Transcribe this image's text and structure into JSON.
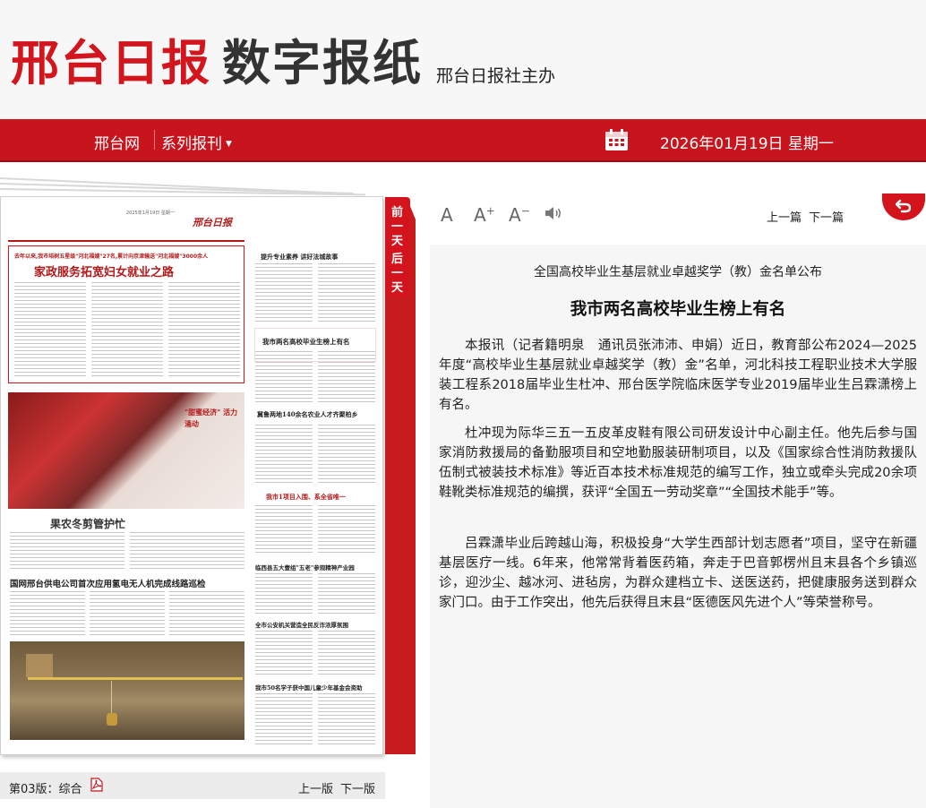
{
  "header": {
    "logo_red": "邢台日报",
    "logo_dark": "数字报纸",
    "subtitle": "邢台日报社主办"
  },
  "nav": {
    "site": "邢台网",
    "series": "系列报刊",
    "date": "2026年01月19日 星期一"
  },
  "side_tab": [
    "前",
    "一",
    "天",
    "后",
    "一",
    "天"
  ],
  "thumbnail": {
    "logo": "邢台日报",
    "section": "综合 3",
    "dateline": "2025年1月19日 星期一",
    "top_kicker": "去年以来,我市培树五星级\"河北福嫂\"27名,累计向京津输送\"河北福嫂\"3000余人",
    "top_title": "家政服务拓宽妇女就业之路",
    "photo_tag": "\"甜蜜经济\" 活力涌动",
    "h2": "果农冬剪管护忙",
    "h3": "国网邢台供电公司首次应用氢电无人机完成线路巡检",
    "r1": "提升专业素养  讲好法城故事",
    "r2": "我市两名高校毕业生榜上有名",
    "r3": "冀鲁两地140余名农业人才齐聚柏乡",
    "r4": "我市1项目入围、系全省唯一",
    "r5": "临西县五大壹组\"五老\"参观精神产业园",
    "r6": "全市公安机关营造全民反诈浓厚氛围",
    "r7": "我市50名学子获中国儿童少年基金会资助"
  },
  "page_footer": {
    "page_label": "第03版：综合",
    "prev": "上一版",
    "next": "下一版"
  },
  "toolbar": {
    "font_default": "A",
    "font_larger": "A",
    "font_larger_mark": "+",
    "font_smaller": "A",
    "font_smaller_mark": "−",
    "prev_article": "上一篇",
    "next_article": "下一篇"
  },
  "article": {
    "kicker": "全国高校毕业生基层就业卓越奖学（教）金名单公布",
    "title": "我市两名高校毕业生榜上有名",
    "paragraphs": [
      "本报讯（记者籍明泉　通讯员张沛沛、申娟）近日，教育部公布2024—2025年度“高校毕业生基层就业卓越奖学（教）金”名单，河北科技工程职业技术大学服装工程系2018届毕业生杜冲、邢台医学院临床医学专业2019届毕业生吕霖潇榜上有名。",
      "杜冲现为际华三五一五皮革皮鞋有限公司研发设计中心副主任。他先后参与国家消防救援局的备勤服项目和空地勤服装研制项目，以及《国家综合性消防救援队伍制式被装技术标准》等近百本技术标准规范的编写工作，独立或牵头完成20余项鞋靴类标准规范的编撰，获评“全国五一劳动奖章”“全国技术能手”等。",
      "吕霖潇毕业后跨越山海，积极投身“大学生西部计划志愿者”项目，坚守在新疆基层医疗一线。6年来，他常常背着医药箱，奔走于巴音郭楞州且末县各个乡镇巡诊，迎沙尘、越冰河、进毡房，为群众建档立卡、送医送药，把健康服务送到群众家门口。由于工作突出，他先后获得且末县“医德医风先进个人”等荣誉称号。"
    ]
  },
  "colors": {
    "brand_red": "#c8141c",
    "logo_red": "#d3151e"
  }
}
